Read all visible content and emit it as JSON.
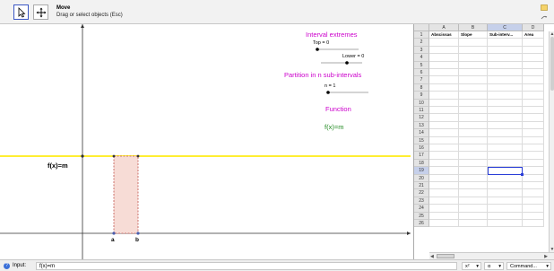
{
  "toolbar": {
    "tool_title": "Move",
    "tool_desc": "Drag or select objects (Esc)",
    "tools": [
      {
        "name": "move",
        "icon": "arrow-pointer-icon",
        "selected": true
      },
      {
        "name": "pan",
        "icon": "move-cross-icon",
        "selected": false
      }
    ],
    "undo_icon": "undo-icon",
    "redo_icon": "redo-icon"
  },
  "graphics": {
    "interval_title": "Interval extremes",
    "top_slider_label": "Top = 0",
    "lower_slider_label": "Lower = 0",
    "partition_title": "Partition in n sub-intervals",
    "n_slider_label": "n = 1",
    "function_title": "Function",
    "function_value": "f(x)=m",
    "curve_label": "f(x)=m",
    "point_a": "a",
    "point_b": "b",
    "colors": {
      "title": "#cc00cc",
      "function": "#228b22",
      "curve": "#ffee33",
      "rect_fill": "#f7dcd6",
      "rect_stroke": "#c0524a"
    }
  },
  "spreadsheet": {
    "columns": [
      "A",
      "B",
      "C",
      "D"
    ],
    "headers": [
      "Abscissas",
      "Slope",
      "Sub-interv...",
      "Area"
    ],
    "rows": [
      "1",
      "2",
      "3",
      "4",
      "5",
      "6",
      "7",
      "8",
      "9",
      "10",
      "11",
      "12",
      "13",
      "14",
      "15",
      "16",
      "17",
      "18",
      "19",
      "20",
      "21",
      "22",
      "23",
      "24",
      "25",
      "26"
    ],
    "selected_column": "C",
    "selected_row": "19"
  },
  "inputbar": {
    "label": "Input:",
    "value": "f(x)=m",
    "help_icon": "help-icon",
    "dropdowns": [
      "x²",
      "α",
      "Command..."
    ]
  }
}
